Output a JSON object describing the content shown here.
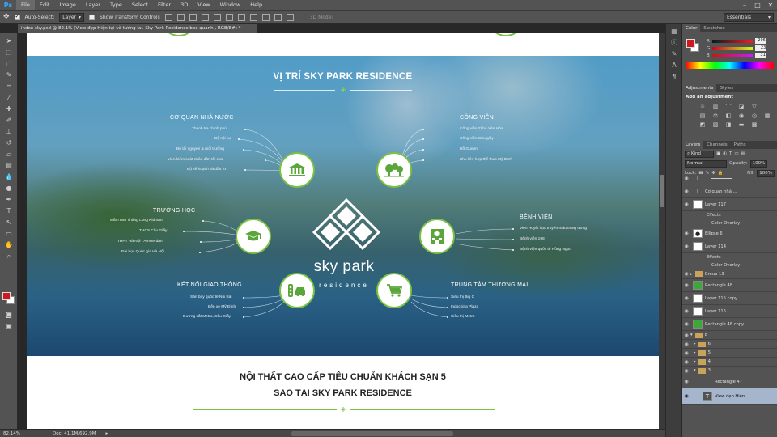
{
  "menubar": {
    "logo": "Ps",
    "items": [
      "File",
      "Edit",
      "Image",
      "Layer",
      "Type",
      "Select",
      "Filter",
      "3D",
      "View",
      "Window",
      "Help"
    ],
    "active_index": 0
  },
  "options": {
    "auto_select_label": "Auto-Select:",
    "auto_select_value": "Layer",
    "show_transform_label": "Show Transform Controls",
    "mode_3d_label": "3D Mode:",
    "workspace": "Essentials"
  },
  "document": {
    "tab_title": "index-sky.psd @ 82.1% (View đẹp   Hiện tại và tương lai. Sky Park Residence bao quanh , RGB/8#) *"
  },
  "hero": {
    "title": "VỊ TRÍ SKY PARK RESIDENCE",
    "logo_name": "sky park",
    "logo_sub": "residence",
    "categories": {
      "co_quan": {
        "title": "CƠ QUAN NHÀ NƯỚC",
        "items": [
          "Thanh tra chính phủ",
          "Bộ nội vụ",
          "Bộ tài nguyên & môi trường",
          "Viện kiểm soát nhân dân tối cao",
          "Bộ kế hoạch và đầu tư"
        ]
      },
      "cong_vien": {
        "title": "CÔNG VIÊN",
        "items": [
          "Công viên Zitha Yên Hòa",
          "Công viên Cầu giấy",
          "Hồ Gumm",
          "Khu liên hợp thể thao Mỹ Đình"
        ]
      },
      "truong_hoc": {
        "title": "TRƯỜNG HỌC",
        "items": [
          "Mầm non Thăng Long Kidmart",
          "THCS Cầu Giấy",
          "THPT Hà Nội - Amsterdam",
          "Đại học Quốc gia Hà Nội"
        ]
      },
      "benh_vien": {
        "title": "BỆNH VIỆN",
        "items": [
          "Viện Huyết học truyền máu trung ương",
          "Bệnh viện 198",
          "Bệnh viện quốc tế Hồng Ngọc"
        ]
      },
      "giao_thong": {
        "title": "KẾT NỐI GIAO THÔNG",
        "items": [
          "Sân bay quốc tế Nội Bài",
          "Bến xe Mỹ Đình",
          "Đường sắt Metro, Cầu Giấy"
        ]
      },
      "thuong_mai": {
        "title": "TRUNG TÂM THƯƠNG MẠI",
        "items": [
          "Siêu thị Big C",
          "Indochina Plaza",
          "Siêu thị Metro"
        ]
      }
    }
  },
  "section2": {
    "line1": "NỘI THẤT CAO CẤP TIÊU CHUẨN KHÁCH SẠN 5",
    "line2": "SAO TẠI SKY PARK RESIDENCE"
  },
  "status": {
    "zoom": "82.14%",
    "doc": "Doc: 41.1M/692.9M"
  },
  "color_panel": {
    "tabs": [
      "Color",
      "Swatches"
    ],
    "r_label": "R",
    "g_label": "G",
    "b_label": "B",
    "r": "206",
    "g": "23",
    "b": "31",
    "fg_color": "#ce171f"
  },
  "adjust_panel": {
    "tabs": [
      "Adjustments",
      "Styles"
    ],
    "title": "Add an adjustment"
  },
  "layers_panel": {
    "tabs": [
      "Layers",
      "Channels",
      "Paths"
    ],
    "kind": "Kind",
    "blend": "Normal",
    "opacity_label": "Opacity:",
    "opacity": "100%",
    "lock_label": "Lock:",
    "fill_label": "Fill:",
    "fill": "100%",
    "layers": [
      {
        "name": "",
        "type": "text"
      },
      {
        "name": "Cơ quan nhà ...",
        "type": "text"
      },
      {
        "name": "Layer 117",
        "type": "image"
      },
      {
        "name": "Effects",
        "type": "sub"
      },
      {
        "name": "Color Overlay",
        "type": "sub2"
      },
      {
        "name": "Ellipse 6",
        "type": "image"
      },
      {
        "name": "Layer 114",
        "type": "image"
      },
      {
        "name": "Effects",
        "type": "sub"
      },
      {
        "name": "Color Overlay",
        "type": "sub2"
      },
      {
        "name": "Group 13",
        "type": "folder"
      },
      {
        "name": "Rectangle 48",
        "type": "green"
      },
      {
        "name": "Layer 115 copy",
        "type": "image"
      },
      {
        "name": "Layer 115",
        "type": "image"
      },
      {
        "name": "Rectangle 48 copy",
        "type": "green"
      },
      {
        "name": "8",
        "type": "folder"
      },
      {
        "name": "6",
        "type": "folder"
      },
      {
        "name": "5",
        "type": "folder"
      },
      {
        "name": "4",
        "type": "folder"
      },
      {
        "name": "3",
        "type": "folder"
      },
      {
        "name": "Rectangle 47",
        "type": "blank"
      },
      {
        "name": "View đẹp   Hiện ...",
        "type": "textsel"
      }
    ]
  }
}
